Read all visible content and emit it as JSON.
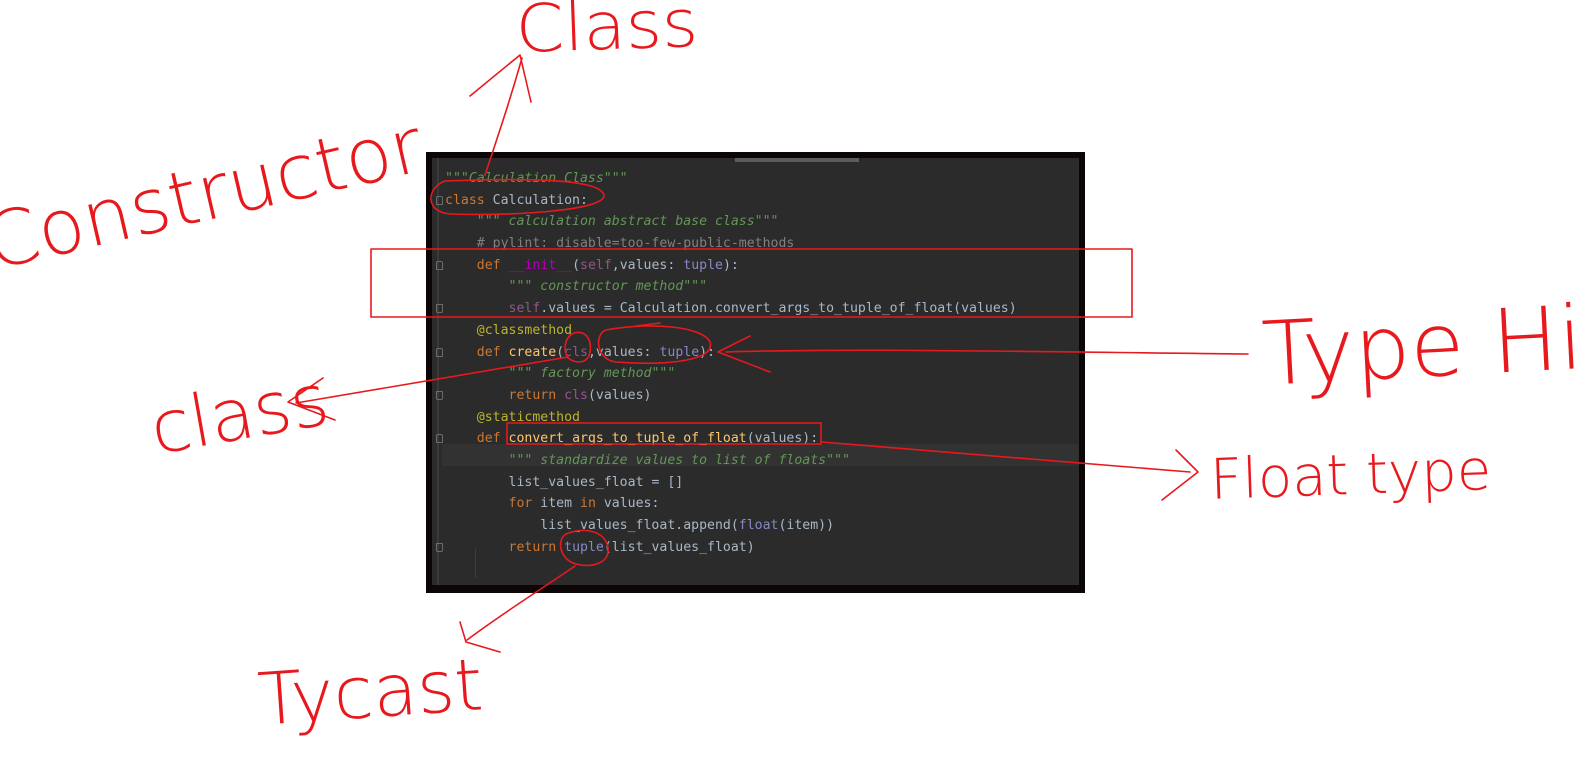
{
  "annotations": {
    "class_top": "Class",
    "constructor": "Constructor",
    "class_left": "class",
    "type_hint": "Type Hint",
    "float_type": "Float type",
    "typecast": "Tycast"
  },
  "colors": {
    "annotation_red": "#e8191d",
    "editor_bg": "#2b2b2b",
    "keyword": "#cc7832",
    "docstring": "#629755",
    "function": "#ffc66d",
    "builtin": "#8888c6",
    "decorator": "#bbb529"
  },
  "code": {
    "l1": {
      "doc": "\"\"\"Calculation Class\"\"\""
    },
    "l2": {
      "kw": "class",
      "name": " Calculation:"
    },
    "l3": {
      "indent": "    ",
      "doc": "\"\"\" calculation abstract base class\"\"\""
    },
    "l4": {
      "indent": "    ",
      "comment": "# pylint: disable=too-few-public-methods"
    },
    "l5": {
      "indent": "    ",
      "kw": "def",
      "sp": " ",
      "fn": "__init__",
      "open": "(",
      "self": "self",
      "args": ",values: ",
      "type": "tuple",
      "close": "):"
    },
    "l6": {
      "indent": "        ",
      "doc": "\"\"\" constructor method\"\"\""
    },
    "l7": {
      "indent": "        ",
      "self": "self",
      "rest": ".values = Calculation.convert_args_to_tuple_of_float(values)"
    },
    "l8": {
      "indent": "    ",
      "deco": "@classmethod"
    },
    "l9": {
      "indent": "    ",
      "kw": "def",
      "sp": " ",
      "fn": "create",
      "open": "(",
      "cls": "cls",
      "args": ",values: ",
      "type": "tuple",
      "close": "):"
    },
    "l10": {
      "indent": "        ",
      "doc": "\"\"\" factory method\"\"\""
    },
    "l11": {
      "indent": "        ",
      "kw": "return",
      "sp": " ",
      "cls": "cls",
      "rest": "(values)"
    },
    "l12": {
      "indent": "    ",
      "deco": "@staticmethod"
    },
    "l13": {
      "indent": "    ",
      "kw": "def",
      "sp": " ",
      "fn": "convert_args_to_tuple_of_float",
      "rest": "(values):"
    },
    "l14": {
      "indent": "        ",
      "doc": "\"\"\" standardize values to list of floats\"\"\""
    },
    "l15": {
      "indent": "        ",
      "rest": "list_values_float = []"
    },
    "l16": {
      "indent": "        ",
      "kw": "for",
      "mid": " item ",
      "kw2": "in",
      "rest": " values:"
    },
    "l17": {
      "indent": "            ",
      "pre": "list_values_float.append(",
      "builtin": "float",
      "rest": "(item))"
    },
    "l18": {
      "indent": "        ",
      "kw": "return",
      "sp": " ",
      "builtin": "tuple",
      "rest": "(list_values_float)"
    }
  }
}
